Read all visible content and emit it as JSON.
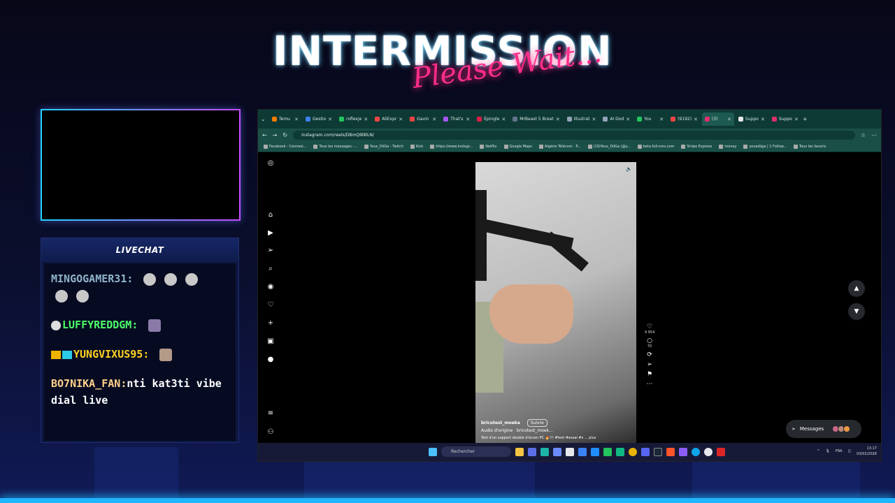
{
  "overlay": {
    "title": "INTERMISSION",
    "subtitle": "Please Wait...",
    "chat_header": "LIVECHAT",
    "chat_messages": [
      {
        "user": "MINGOGAMER31:",
        "text": ""
      },
      {
        "user": "LUFFYREDDGM:",
        "text": ""
      },
      {
        "user": "YUNGVIXUS95:",
        "text": ""
      },
      {
        "user": "BO7NIKA_FAN:",
        "text": "nti kat3ti vibe dial live"
      }
    ]
  },
  "browser": {
    "tabs": [
      {
        "label": "Temu",
        "color": "#f57c00"
      },
      {
        "label": "Gestio",
        "color": "#3b82f6"
      },
      {
        "label": "roflexje",
        "color": "#22c55e"
      },
      {
        "label": "AliExpr",
        "color": "#ef4444"
      },
      {
        "label": "Gavin",
        "color": "#ef4444"
      },
      {
        "label": "That's",
        "color": "#a855f7"
      },
      {
        "label": "Épingle",
        "color": "#e11d48"
      },
      {
        "label": "MrBeast 5 Breat",
        "color": "#64748b"
      },
      {
        "label": "Illustrat",
        "color": "#94a3b8"
      },
      {
        "label": "AI Dod",
        "color": "#94a3b8"
      },
      {
        "label": "You",
        "color": "#22c55e"
      },
      {
        "label": "(9192)",
        "color": "#ef4444"
      },
      {
        "label": "(3)",
        "color": "#e1306c"
      },
      {
        "label": "Suppo",
        "color": "#e5e7eb"
      },
      {
        "label": "Suppo",
        "color": "#e1306c"
      }
    ],
    "url": "instagram.com/reels/DBmQ9l8lLN/",
    "bookmarks": [
      "Facebook - Connexi...",
      "Tous les messages -...",
      "Yous_DiiGa - Twitch",
      "Kick",
      "https://www.instagr...",
      "Netflix",
      "Google Maps",
      "Algérie Télécom - P...",
      "(19)Yous_DiiGa (@y...",
      "beta.full-sms.com",
      "Stripe Express",
      "money",
      "yousdiiga | 1 Follow...",
      "Tous les favoris"
    ]
  },
  "reel": {
    "username": "bricotest_moeka",
    "follow_label": "Suivre",
    "audio": "Audio d'origine · bricotest_moek...",
    "caption": "Test d'un support double d'écran PC 🔥!!! #test #essai #s ... plus",
    "likes": "9 954",
    "comments": "70"
  },
  "messages_button": "Messages",
  "messages_badge": "1",
  "taskbar": {
    "search_placeholder": "Rechercher",
    "lang": "FRA",
    "time": "13:17",
    "date": "03/02/2026"
  }
}
